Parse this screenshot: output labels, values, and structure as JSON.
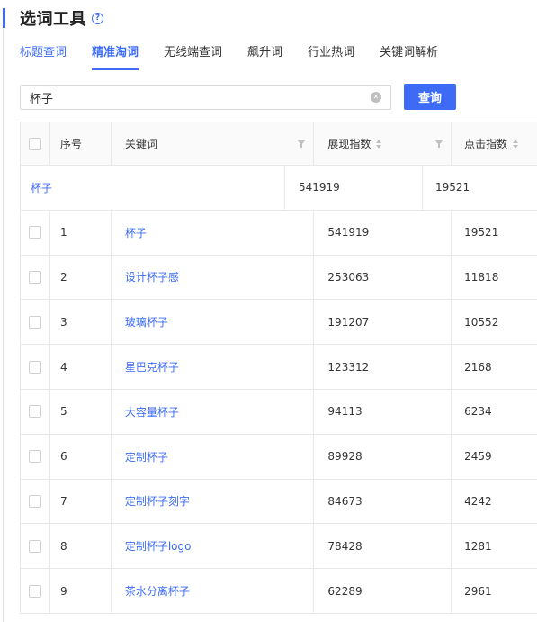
{
  "header": {
    "title": "选词工具",
    "help_icon": "?"
  },
  "tabs": [
    {
      "label": "标题查词"
    },
    {
      "label": "精准淘词"
    },
    {
      "label": "无线端查词"
    },
    {
      "label": "飙升词"
    },
    {
      "label": "行业热词"
    },
    {
      "label": "关键词解析"
    }
  ],
  "search": {
    "value": "杯子",
    "button_label": "查询"
  },
  "table": {
    "columns": {
      "seq": "序号",
      "keyword": "关键词",
      "show_index": "展现指数",
      "click_index": "点击指数"
    },
    "summary": {
      "keyword": "杯子",
      "show_index": "541919",
      "click_index": "19521"
    },
    "rows": [
      {
        "seq": "1",
        "keyword": "杯子",
        "show_index": "541919",
        "click_index": "19521"
      },
      {
        "seq": "2",
        "keyword": "设计杯子感",
        "show_index": "253063",
        "click_index": "11818"
      },
      {
        "seq": "3",
        "keyword": "玻璃杯子",
        "show_index": "191207",
        "click_index": "10552"
      },
      {
        "seq": "4",
        "keyword": "星巴克杯子",
        "show_index": "123312",
        "click_index": "2168"
      },
      {
        "seq": "5",
        "keyword": "大容量杯子",
        "show_index": "94113",
        "click_index": "6234"
      },
      {
        "seq": "6",
        "keyword": "定制杯子",
        "show_index": "89928",
        "click_index": "2459"
      },
      {
        "seq": "7",
        "keyword": "定制杯子刻字",
        "show_index": "84673",
        "click_index": "4242"
      },
      {
        "seq": "8",
        "keyword": "定制杯子logo",
        "show_index": "78428",
        "click_index": "1281"
      },
      {
        "seq": "9",
        "keyword": "茶水分离杯子",
        "show_index": "62289",
        "click_index": "2961"
      }
    ]
  },
  "colors": {
    "accent": "#3d6bf6",
    "border": "#e8e8e8",
    "header_bg": "#fafafa"
  }
}
